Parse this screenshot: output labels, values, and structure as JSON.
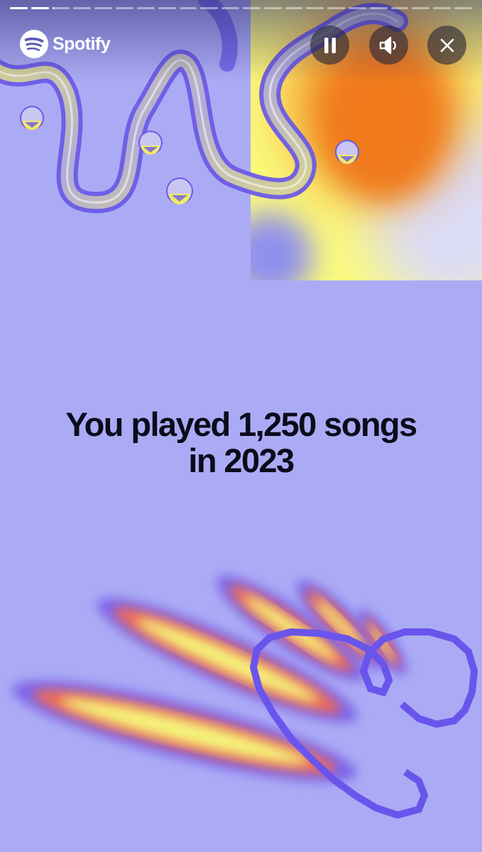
{
  "brand": {
    "name": "Spotify",
    "logo_icon": "spotify-logo-icon"
  },
  "story_progress": {
    "total_segments": 22,
    "completed_segments": 2,
    "current_segment_fraction": 0.1
  },
  "controls": {
    "pause_icon": "pause-icon",
    "sound_icon": "speaker-icon",
    "close_icon": "close-icon"
  },
  "headline": {
    "line1": "You played 1,250 songs",
    "line2": "in 2023"
  },
  "colors": {
    "background": "#ababf5",
    "accent_purple": "#6a55ec",
    "accent_yellow": "#f4f56a",
    "accent_orange": "#f07a22",
    "text": "#0b0b1a"
  }
}
